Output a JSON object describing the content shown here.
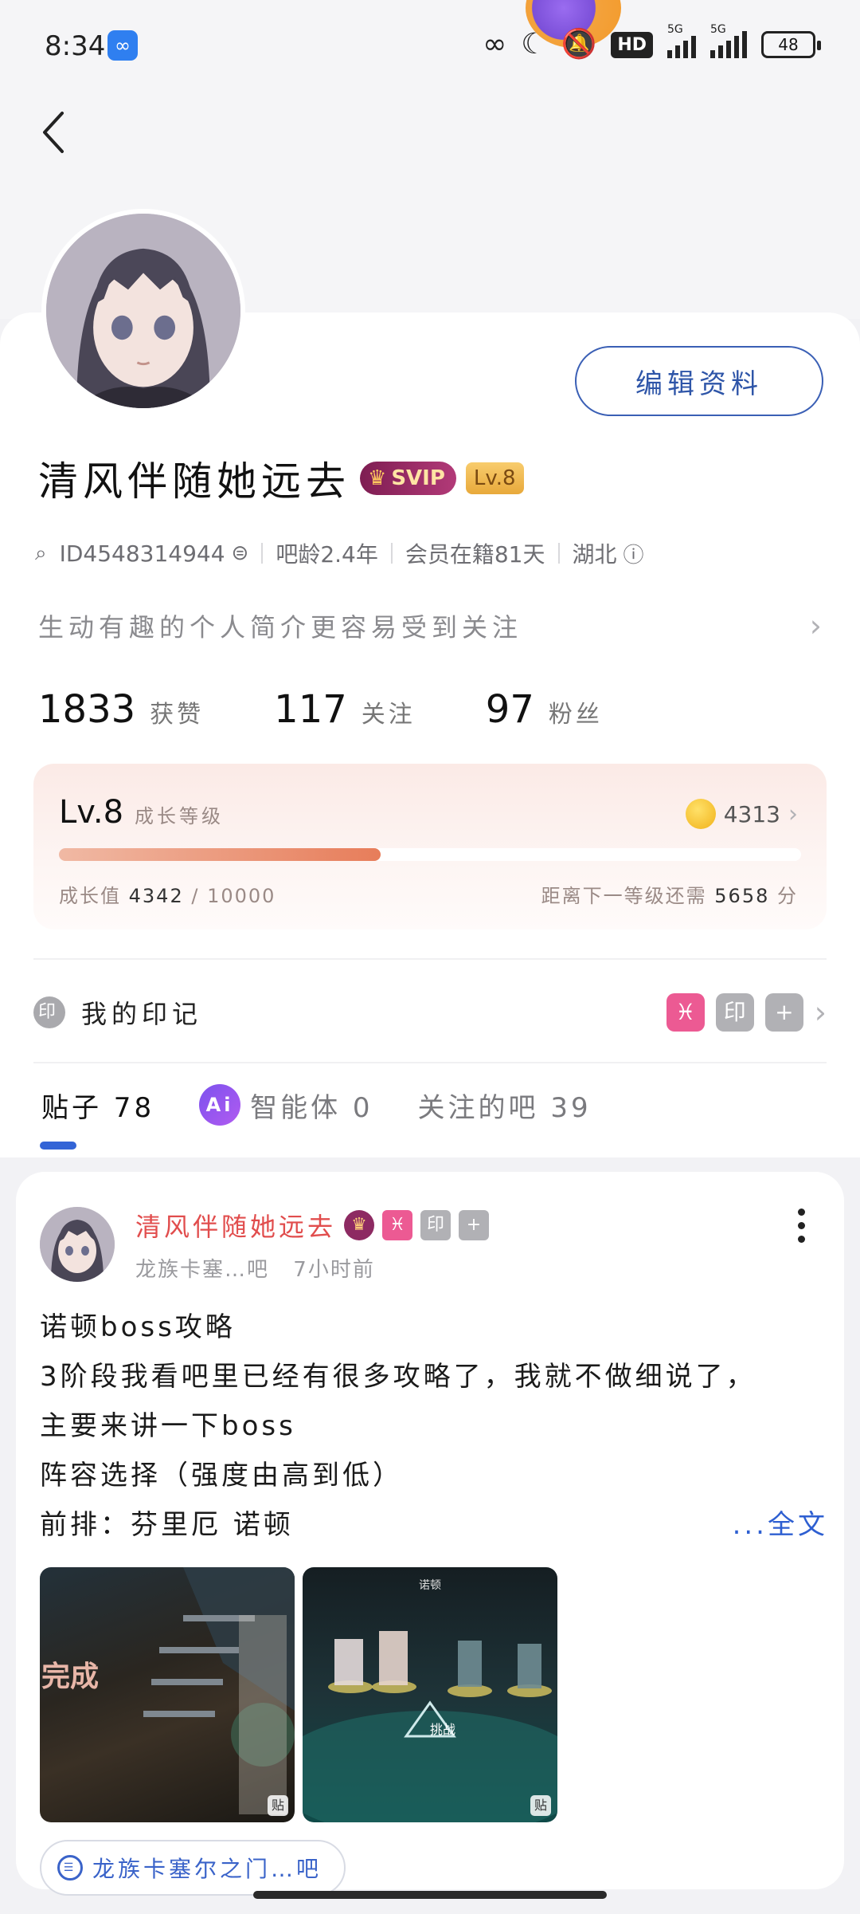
{
  "status_bar": {
    "time": "8:34",
    "hd_label": "HD",
    "network_left": "5G",
    "network_right": "5G",
    "battery": "48"
  },
  "profile": {
    "name": "清风伴随她远去",
    "svip_label": "SVIP",
    "level_badge": "Lv.8",
    "edit_button": "编辑资料",
    "id_text": "ID4548314944",
    "bar_age": "吧龄2.4年",
    "member_days": "会员在籍81天",
    "location": "湖北",
    "bio_placeholder": "生动有趣的个人简介更容易受到关注",
    "stats": {
      "likes_count": "1833",
      "likes_label": "获赞",
      "following_count": "117",
      "following_label": "关注",
      "fans_count": "97",
      "fans_label": "粉丝"
    }
  },
  "level_card": {
    "level": "Lv.8",
    "level_sub": "成长等级",
    "coins": "4313",
    "growth_label": "成长值",
    "growth_current": "4342",
    "growth_total": "/ 10000",
    "growth_progress": 0.434,
    "next_label": "距离下一等级还需",
    "next_value": "5658",
    "next_unit": "分"
  },
  "marks": {
    "icon_text": "印",
    "label": "我的印记",
    "tag_1": "♓",
    "tag_2": "印",
    "tag_3": "+"
  },
  "tabs": {
    "posts": "贴子 78",
    "ai_icon": "Ai",
    "agents": "智能体 0",
    "followed_bars": "关注的吧 39"
  },
  "post": {
    "author": "清风伴随她远去",
    "tag_1": "♓",
    "tag_2": "印",
    "tag_3": "+",
    "source": "龙族卡塞…吧",
    "time": "7小时前",
    "lines": [
      "诺顿boss攻略",
      "3阶段我看吧里已经有很多攻略了，我就不做细说了，",
      "主要来讲一下boss",
      "阵容选择（强度由高到低）",
      "前排：芬里厄 诺顿"
    ],
    "full_text_link": "...全文",
    "image_a_text": "完成",
    "image_b_title": "诺顿",
    "image_b_fight": "挑战",
    "image_badge": "贴",
    "bar_chip": "龙族卡塞尔之门…吧"
  },
  "colors": {
    "accent_blue": "#3364d6",
    "author_red": "#e14d4d",
    "svip_purple": "#7e1d52"
  }
}
